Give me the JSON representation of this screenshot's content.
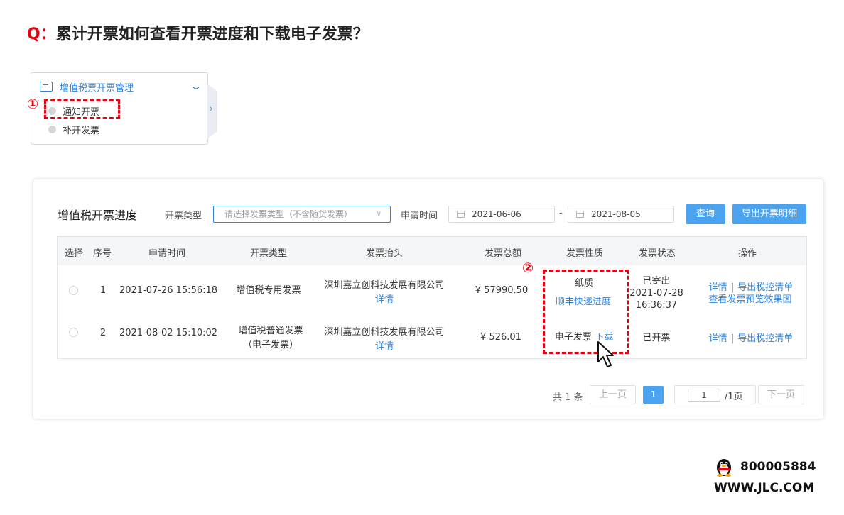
{
  "heading": {
    "q_label": "Q：",
    "text": "累计开票如何查看开票进度和下载电子发票？"
  },
  "menu": {
    "title": "增值税票开票管理",
    "items": [
      "通知开票",
      "补开发票"
    ],
    "step1": "①"
  },
  "panel": {
    "title": "增值税开票进度",
    "type_label": "开票类型",
    "type_placeholder": "请选择发票类型（不含随货发票）",
    "time_label": "申请时间",
    "date_from": "2021-06-06",
    "date_sep": "-",
    "date_to": "2021-08-05",
    "query_btn": "查询",
    "export_btn": "导出开票明细"
  },
  "table": {
    "headers": [
      "选择",
      "序号",
      "申请时间",
      "开票类型",
      "发票抬头",
      "发票总额",
      "发票性质",
      "发票状态",
      "操作"
    ],
    "rows": [
      {
        "index": "1",
        "time": "2021-07-26 15:56:18",
        "type": "增值税专用发票",
        "title_name": "深圳嘉立创科技发展有限公司",
        "title_link": "详情",
        "amount": "¥ 57990.50",
        "nature": "纸质",
        "nature_link": "顺丰快递进度",
        "status_1": "已寄出",
        "status_2": "2021-07-28",
        "status_3": "16:36:37",
        "op_detail": "详情",
        "op_sep": "|",
        "op_export": "导出税控清单",
        "op_preview": "查看发票预览效果图"
      },
      {
        "index": "2",
        "time": "2021-08-02 15:10:02",
        "type_1": "增值税普通发票",
        "type_2": "（电子发票）",
        "title_name": "深圳嘉立创科技发展有限公司",
        "title_link": "详情",
        "amount": "¥ 526.01",
        "nature": "电子发票",
        "nature_link": "下载",
        "status": "已开票",
        "op_detail": "详情",
        "op_sep": "|",
        "op_export": "导出税控清单"
      }
    ],
    "step2": "②"
  },
  "pagination": {
    "total": "共 1 条",
    "prev": "上一页",
    "current": "1",
    "input_value": "1",
    "total_pages": "/1页",
    "next": "下一页"
  },
  "footer": {
    "qq": "800005884",
    "site": "WWW.JLC.COM"
  },
  "colors": {
    "accent": "#2f83d8",
    "button": "#4ba2ef",
    "highlight": "#e60012"
  }
}
